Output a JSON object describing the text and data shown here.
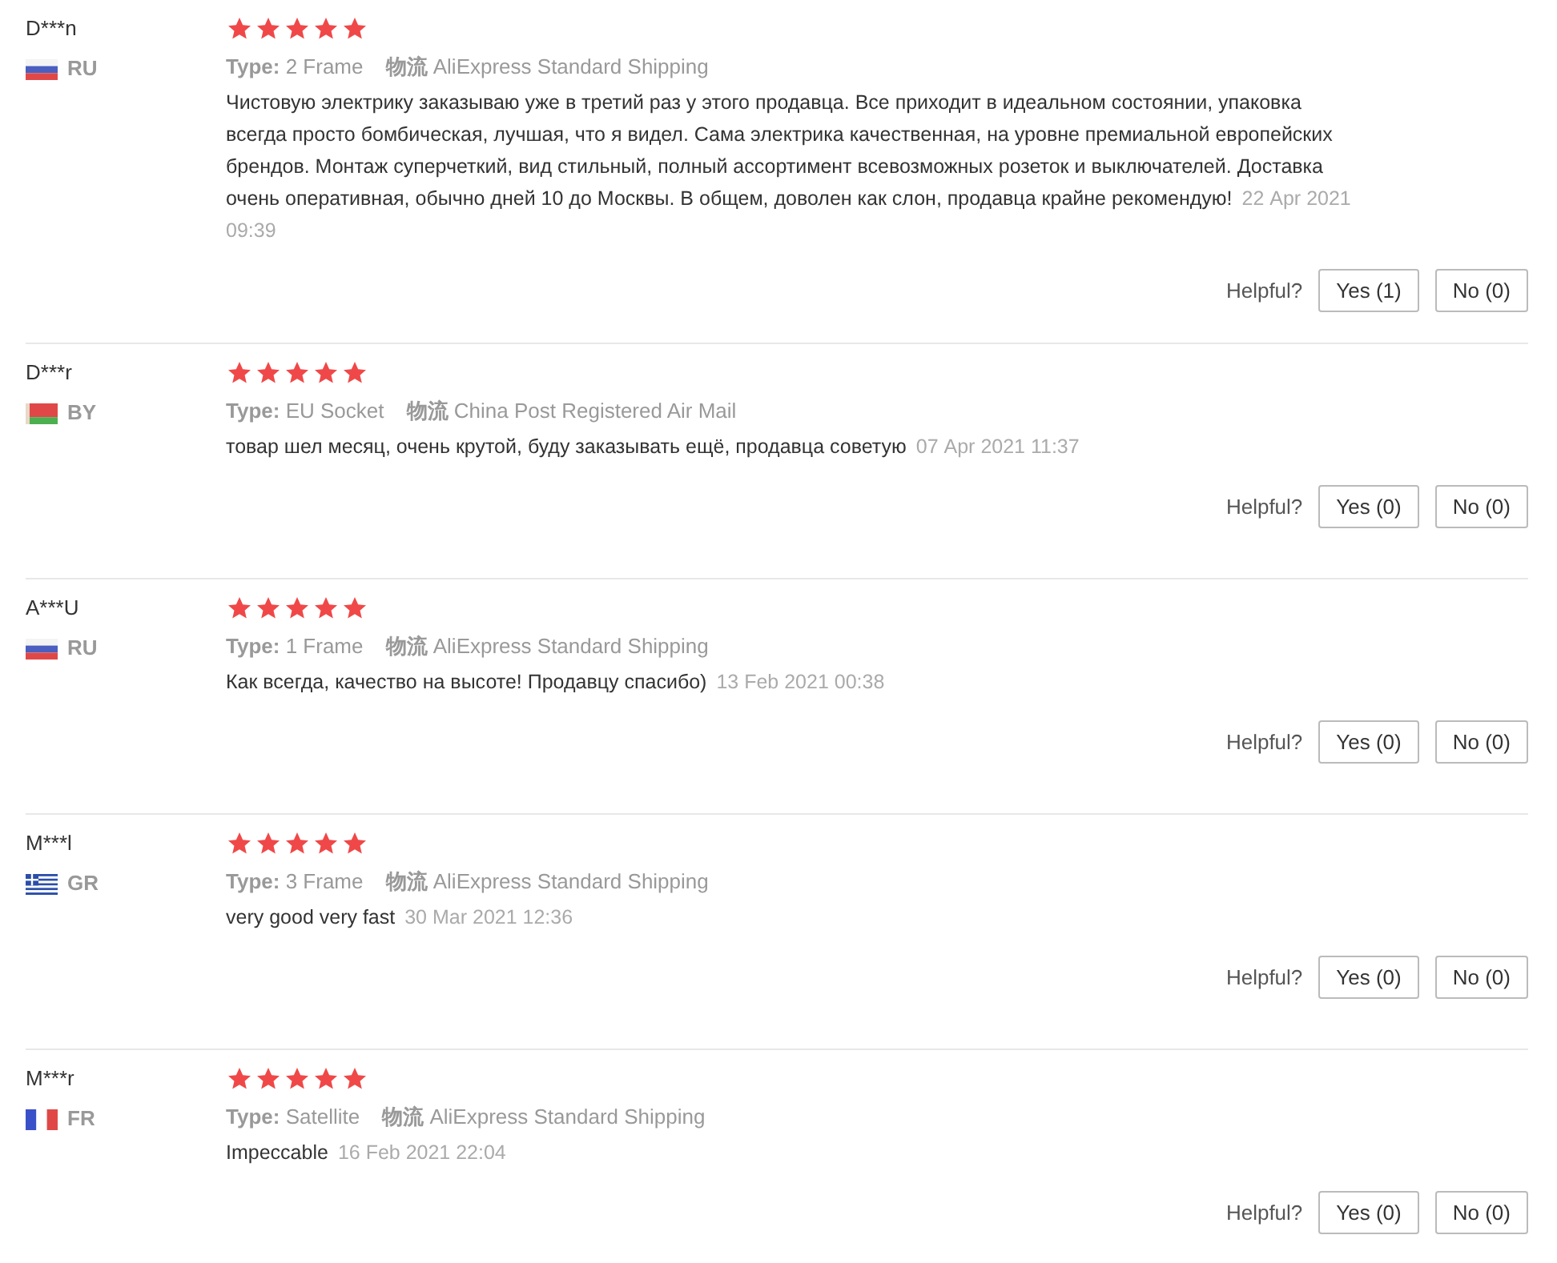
{
  "reviews": [
    {
      "user": "D***n",
      "kind": "ru",
      "country": "RU",
      "stars": 5,
      "type_label": "Type:",
      "type": "2 Frame",
      "shipping_label": "物流",
      "shipping": "AliExpress Standard Shipping",
      "text": "Чистовую электрику заказываю уже в третий раз у этого продавца. Все приходит в идеальном состоянии, упаковка всегда просто бомбическая, лучшая, что я видел. Сама электрика качественная, на уровне премиальной европейских брендов. Монтаж суперчеткий, вид стильный, полный ассортимент всевозможных розеток и выключателей. Доставка очень оперативная, обычно дней 10 до Москвы. В общем, доволен как слон, продавца крайне рекомендую!",
      "date": "22 Apr 2021 09:39",
      "helpful": "Helpful?",
      "yes": "Yes (1)",
      "no": "No (0)"
    },
    {
      "user": "D***r",
      "kind": "by",
      "country": "BY",
      "stars": 5,
      "type_label": "Type:",
      "type": "EU Socket",
      "shipping_label": "物流",
      "shipping": "China Post Registered Air Mail",
      "text": "товар шел месяц, очень крутой, буду заказывать ещё, продавца советую",
      "date": "07 Apr 2021 11:37",
      "helpful": "Helpful?",
      "yes": "Yes (0)",
      "no": "No (0)"
    },
    {
      "user": "A***U",
      "kind": "ru",
      "country": "RU",
      "stars": 5,
      "type_label": "Type:",
      "type": "1 Frame",
      "shipping_label": "物流",
      "shipping": "AliExpress Standard Shipping",
      "text": "Как всегда, качество на высоте! Продавцу спасибо)",
      "date": "13 Feb 2021 00:38",
      "helpful": "Helpful?",
      "yes": "Yes (0)",
      "no": "No (0)"
    },
    {
      "user": "M***l",
      "kind": "gr",
      "country": "GR",
      "stars": 5,
      "type_label": "Type:",
      "type": "3 Frame",
      "shipping_label": "物流",
      "shipping": "AliExpress Standard Shipping",
      "text": "very good very fast",
      "date": "30 Mar 2021 12:36",
      "helpful": "Helpful?",
      "yes": "Yes (0)",
      "no": "No (0)"
    },
    {
      "user": "M***r",
      "kind": "fr",
      "country": "FR",
      "stars": 5,
      "type_label": "Type:",
      "type": "Satellite",
      "shipping_label": "物流",
      "shipping": "AliExpress Standard Shipping",
      "text": "Impeccable",
      "date": "16 Feb 2021 22:04",
      "helpful": "Helpful?",
      "yes": "Yes (0)",
      "no": "No (0)"
    }
  ]
}
